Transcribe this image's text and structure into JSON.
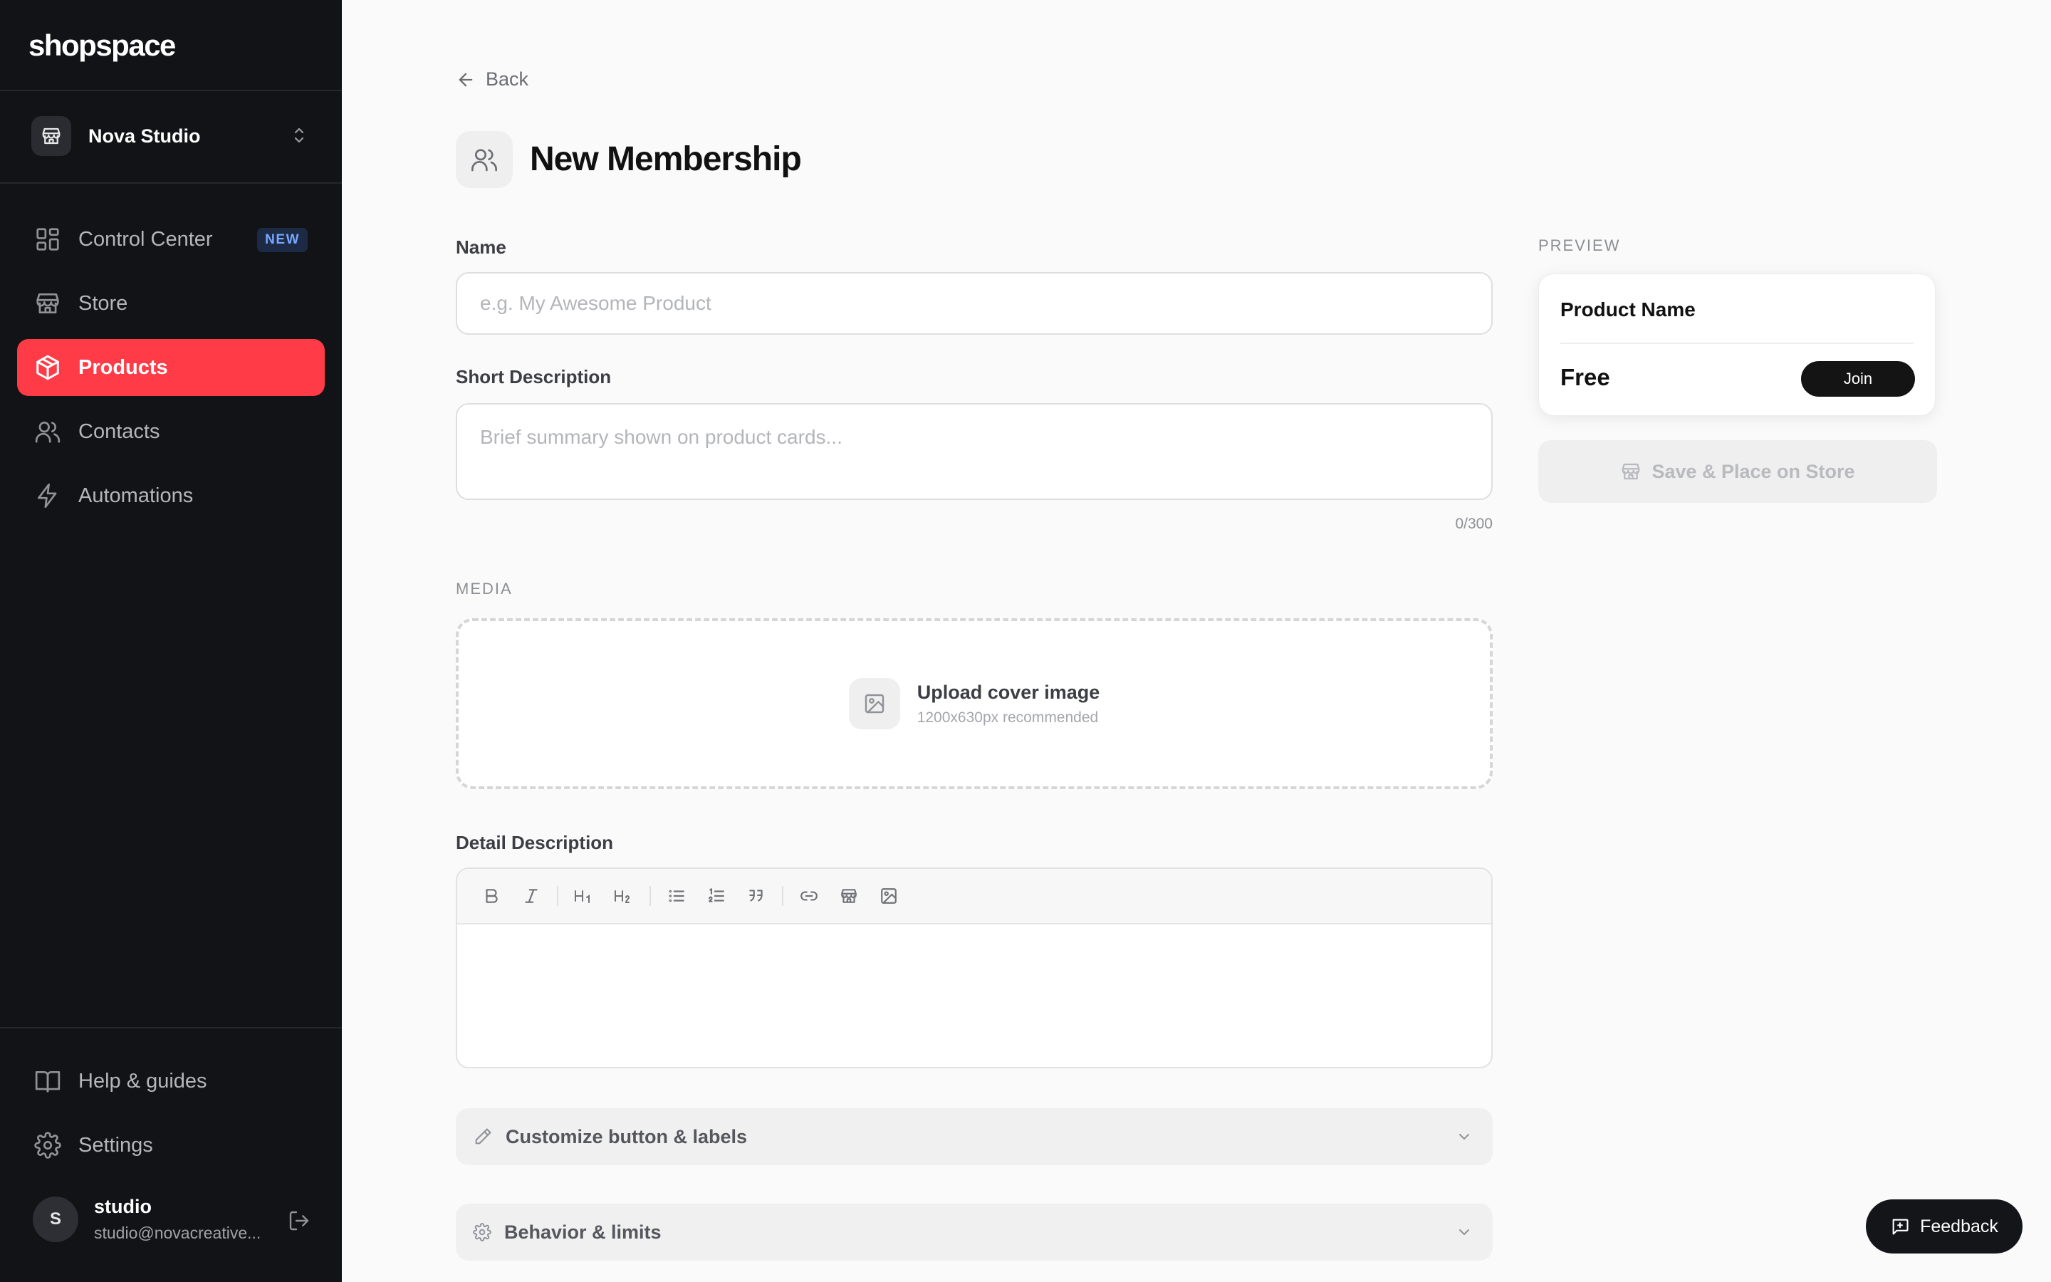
{
  "app": {
    "logo": "shopspace",
    "store_name": "Nova Studio"
  },
  "sidebar": {
    "nav": [
      {
        "label": "Control Center",
        "icon": "grid-icon",
        "badge": "NEW",
        "active": false
      },
      {
        "label": "Store",
        "icon": "store-icon",
        "active": false
      },
      {
        "label": "Products",
        "icon": "box-icon",
        "active": true
      },
      {
        "label": "Contacts",
        "icon": "users-icon",
        "active": false
      },
      {
        "label": "Automations",
        "icon": "bolt-icon",
        "active": false
      }
    ],
    "bottom": [
      {
        "label": "Help & guides",
        "icon": "book-icon"
      },
      {
        "label": "Settings",
        "icon": "gear-icon"
      }
    ],
    "user": {
      "initial": "S",
      "name": "studio",
      "email": "studio@novacreative..."
    }
  },
  "main": {
    "back_label": "Back",
    "title": "New Membership",
    "name_label": "Name",
    "name_placeholder": "e.g. My Awesome Product",
    "name_value": "",
    "short_desc_label": "Short Description",
    "short_desc_placeholder": "Brief summary shown on product cards...",
    "short_desc_value": "",
    "char_count": "0/300",
    "media_label": "MEDIA",
    "upload_title": "Upload cover image",
    "upload_hint": "1200x630px recommended",
    "detail_desc_label": "Detail Description",
    "toolbar": [
      "bold",
      "italic",
      "heading-1",
      "heading-2",
      "bullet-list",
      "numbered-list",
      "quote",
      "link",
      "store-embed",
      "image"
    ],
    "accordions": [
      {
        "label": "Customize button & labels",
        "icon": "pencil-icon"
      },
      {
        "label": "Behavior & limits",
        "icon": "gear-icon"
      }
    ]
  },
  "preview": {
    "label": "PREVIEW",
    "product_name": "Product Name",
    "price": "Free",
    "join_label": "Join",
    "save_label": "Save & Place on Store"
  },
  "feedback_label": "Feedback",
  "colors": {
    "sidebar_bg": "#121316",
    "accent": "#ff3b47",
    "page_bg": "#fafafa",
    "dark_button": "#141414"
  }
}
